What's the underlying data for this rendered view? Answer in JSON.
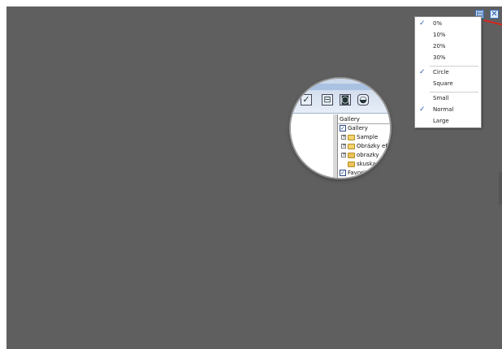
{
  "menu": {
    "items": [
      {
        "label": "0%",
        "checked": true
      },
      {
        "label": "10%",
        "checked": false
      },
      {
        "label": "20%",
        "checked": false
      },
      {
        "label": "30%",
        "checked": false
      },
      {
        "label": "Circle",
        "checked": true
      },
      {
        "label": "Square",
        "checked": false
      },
      {
        "label": "Small",
        "checked": false
      },
      {
        "label": "Normal",
        "checked": true
      },
      {
        "label": "Large",
        "checked": false
      }
    ],
    "check_glyph": "✓"
  },
  "buttons": {
    "options_icon": "menu-icon",
    "close_icon": "close-icon",
    "close_glyph": "✕",
    "options_glyph": "▤"
  },
  "magnified": {
    "gallery_header": "Gallery",
    "tree": [
      {
        "label": "Gallery",
        "type": "checkbox"
      },
      {
        "label": "Sample",
        "type": "folder"
      },
      {
        "label": "Obrázky eBe",
        "type": "folder"
      },
      {
        "label": "obrazky",
        "type": "folder"
      },
      {
        "label": "skuska",
        "type": "folder"
      },
      {
        "label": "Favorites",
        "type": "checkbox"
      }
    ],
    "check_glyph": "✓",
    "expand_glyph": "+"
  },
  "colors": {
    "backdrop": "#5f5f5f",
    "check": "#2a5db0",
    "red_line": "#d8261e"
  }
}
